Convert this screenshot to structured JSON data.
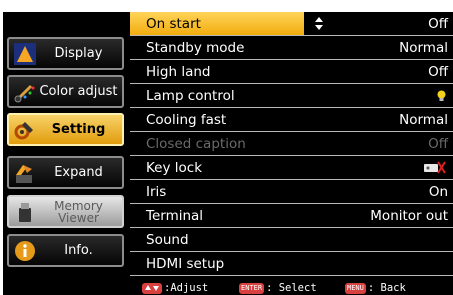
{
  "sidebar": {
    "items": [
      {
        "label": "Display",
        "icon": "display-icon"
      },
      {
        "label": "Color adjust",
        "icon": "color-adjust-icon"
      },
      {
        "label": "Setting",
        "icon": "setting-icon",
        "active": true
      },
      {
        "label": "Expand",
        "icon": "expand-icon"
      },
      {
        "label": "Memory Viewer",
        "icon": "memory-viewer-icon",
        "disabled": true
      },
      {
        "label": "Info.",
        "icon": "info-icon"
      }
    ]
  },
  "menu": {
    "rows": [
      {
        "label": "On start",
        "value": "Off",
        "selected": true
      },
      {
        "label": "Standby mode",
        "value": "Normal"
      },
      {
        "label": "High land",
        "value": "Off"
      },
      {
        "label": "Lamp control",
        "value": "",
        "value_icon": "lamp-icon"
      },
      {
        "label": "Cooling fast",
        "value": "Normal"
      },
      {
        "label": "Closed caption",
        "value": "Off",
        "disabled": true
      },
      {
        "label": "Key lock",
        "value": "",
        "value_icon": "key-lock-icon"
      },
      {
        "label": "Iris",
        "value": "On"
      },
      {
        "label": "Terminal",
        "value": "Monitor out"
      },
      {
        "label": "Sound",
        "value": ""
      },
      {
        "label": "HDMI setup",
        "value": ""
      }
    ]
  },
  "footer": {
    "adjust_label": ":Adjust",
    "enter_key": "ENTER",
    "select_label": ": Select",
    "menu_key": "MENU",
    "back_label": ": Back"
  },
  "colors": {
    "highlight": "#f5b41e",
    "background": "#000000",
    "key_badge": "#d94040"
  }
}
